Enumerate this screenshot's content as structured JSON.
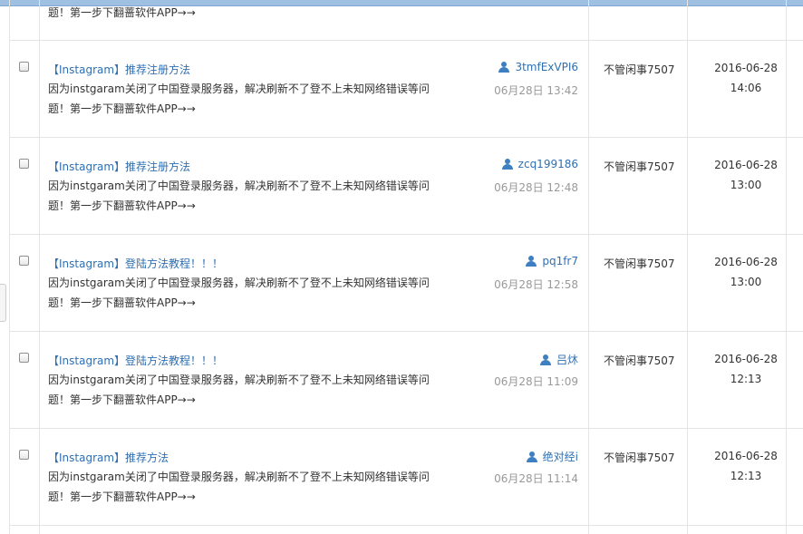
{
  "partial_row": {
    "summary_tail": "题！第一步下翻蔷软件APP→→"
  },
  "rows": [
    {
      "title": "【Instagram】推荐注册方法",
      "summary": "因为instgaram关闭了中国登录服务器，解决刷新不了登不上未知网络错误等问题！第一步下翻蔷软件APP→→",
      "author": "3tmfExVPI6",
      "post_time": "06月28日 13:42",
      "last_reply_user": "不管闲事7507",
      "last_reply_date": "2016-06-28",
      "last_reply_time": "14:06"
    },
    {
      "title": "【Instagram】推荐注册方法",
      "summary": "因为instgaram关闭了中国登录服务器，解决刷新不了登不上未知网络错误等问题！第一步下翻蔷软件APP→→",
      "author": "zcq199186",
      "post_time": "06月28日 12:48",
      "last_reply_user": "不管闲事7507",
      "last_reply_date": "2016-06-28",
      "last_reply_time": "13:00"
    },
    {
      "title": "【Instagram】登陆方法教程！！！",
      "summary": "因为instgaram关闭了中国登录服务器，解决刷新不了登不上未知网络错误等问题！第一步下翻蔷软件APP→→",
      "author": "pq1fr7",
      "post_time": "06月28日 12:58",
      "last_reply_user": "不管闲事7507",
      "last_reply_date": "2016-06-28",
      "last_reply_time": "13:00"
    },
    {
      "title": "【Instagram】登陆方法教程！！！",
      "summary": "因为instgaram关闭了中国登录服务器，解决刷新不了登不上未知网络错误等问题！第一步下翻蔷软件APP→→",
      "author": "吕炑",
      "post_time": "06月28日 11:09",
      "last_reply_user": "不管闲事7507",
      "last_reply_date": "2016-06-28",
      "last_reply_time": "12:13"
    },
    {
      "title": "【Instagram】推荐方法",
      "summary": "因为instgaram关闭了中国登录服务器，解决刷新不了登不上未知网络错误等问题！第一步下翻蔷软件APP→→",
      "author": "绝对经i",
      "post_time": "06月28日 11:14",
      "last_reply_user": "不管闲事7507",
      "last_reply_date": "2016-06-28",
      "last_reply_time": "12:13"
    }
  ]
}
